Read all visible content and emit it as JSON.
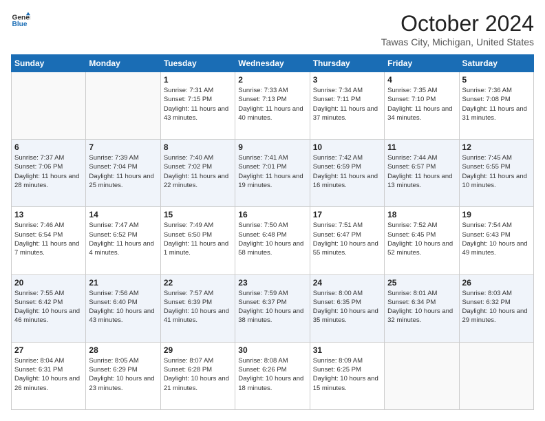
{
  "logo": {
    "line1": "General",
    "line2": "Blue"
  },
  "header": {
    "title": "October 2024",
    "location": "Tawas City, Michigan, United States"
  },
  "weekdays": [
    "Sunday",
    "Monday",
    "Tuesday",
    "Wednesday",
    "Thursday",
    "Friday",
    "Saturday"
  ],
  "weeks": [
    [
      {
        "day": "",
        "info": ""
      },
      {
        "day": "",
        "info": ""
      },
      {
        "day": "1",
        "info": "Sunrise: 7:31 AM\nSunset: 7:15 PM\nDaylight: 11 hours and 43 minutes."
      },
      {
        "day": "2",
        "info": "Sunrise: 7:33 AM\nSunset: 7:13 PM\nDaylight: 11 hours and 40 minutes."
      },
      {
        "day": "3",
        "info": "Sunrise: 7:34 AM\nSunset: 7:11 PM\nDaylight: 11 hours and 37 minutes."
      },
      {
        "day": "4",
        "info": "Sunrise: 7:35 AM\nSunset: 7:10 PM\nDaylight: 11 hours and 34 minutes."
      },
      {
        "day": "5",
        "info": "Sunrise: 7:36 AM\nSunset: 7:08 PM\nDaylight: 11 hours and 31 minutes."
      }
    ],
    [
      {
        "day": "6",
        "info": "Sunrise: 7:37 AM\nSunset: 7:06 PM\nDaylight: 11 hours and 28 minutes."
      },
      {
        "day": "7",
        "info": "Sunrise: 7:39 AM\nSunset: 7:04 PM\nDaylight: 11 hours and 25 minutes."
      },
      {
        "day": "8",
        "info": "Sunrise: 7:40 AM\nSunset: 7:02 PM\nDaylight: 11 hours and 22 minutes."
      },
      {
        "day": "9",
        "info": "Sunrise: 7:41 AM\nSunset: 7:01 PM\nDaylight: 11 hours and 19 minutes."
      },
      {
        "day": "10",
        "info": "Sunrise: 7:42 AM\nSunset: 6:59 PM\nDaylight: 11 hours and 16 minutes."
      },
      {
        "day": "11",
        "info": "Sunrise: 7:44 AM\nSunset: 6:57 PM\nDaylight: 11 hours and 13 minutes."
      },
      {
        "day": "12",
        "info": "Sunrise: 7:45 AM\nSunset: 6:55 PM\nDaylight: 11 hours and 10 minutes."
      }
    ],
    [
      {
        "day": "13",
        "info": "Sunrise: 7:46 AM\nSunset: 6:54 PM\nDaylight: 11 hours and 7 minutes."
      },
      {
        "day": "14",
        "info": "Sunrise: 7:47 AM\nSunset: 6:52 PM\nDaylight: 11 hours and 4 minutes."
      },
      {
        "day": "15",
        "info": "Sunrise: 7:49 AM\nSunset: 6:50 PM\nDaylight: 11 hours and 1 minute."
      },
      {
        "day": "16",
        "info": "Sunrise: 7:50 AM\nSunset: 6:48 PM\nDaylight: 10 hours and 58 minutes."
      },
      {
        "day": "17",
        "info": "Sunrise: 7:51 AM\nSunset: 6:47 PM\nDaylight: 10 hours and 55 minutes."
      },
      {
        "day": "18",
        "info": "Sunrise: 7:52 AM\nSunset: 6:45 PM\nDaylight: 10 hours and 52 minutes."
      },
      {
        "day": "19",
        "info": "Sunrise: 7:54 AM\nSunset: 6:43 PM\nDaylight: 10 hours and 49 minutes."
      }
    ],
    [
      {
        "day": "20",
        "info": "Sunrise: 7:55 AM\nSunset: 6:42 PM\nDaylight: 10 hours and 46 minutes."
      },
      {
        "day": "21",
        "info": "Sunrise: 7:56 AM\nSunset: 6:40 PM\nDaylight: 10 hours and 43 minutes."
      },
      {
        "day": "22",
        "info": "Sunrise: 7:57 AM\nSunset: 6:39 PM\nDaylight: 10 hours and 41 minutes."
      },
      {
        "day": "23",
        "info": "Sunrise: 7:59 AM\nSunset: 6:37 PM\nDaylight: 10 hours and 38 minutes."
      },
      {
        "day": "24",
        "info": "Sunrise: 8:00 AM\nSunset: 6:35 PM\nDaylight: 10 hours and 35 minutes."
      },
      {
        "day": "25",
        "info": "Sunrise: 8:01 AM\nSunset: 6:34 PM\nDaylight: 10 hours and 32 minutes."
      },
      {
        "day": "26",
        "info": "Sunrise: 8:03 AM\nSunset: 6:32 PM\nDaylight: 10 hours and 29 minutes."
      }
    ],
    [
      {
        "day": "27",
        "info": "Sunrise: 8:04 AM\nSunset: 6:31 PM\nDaylight: 10 hours and 26 minutes."
      },
      {
        "day": "28",
        "info": "Sunrise: 8:05 AM\nSunset: 6:29 PM\nDaylight: 10 hours and 23 minutes."
      },
      {
        "day": "29",
        "info": "Sunrise: 8:07 AM\nSunset: 6:28 PM\nDaylight: 10 hours and 21 minutes."
      },
      {
        "day": "30",
        "info": "Sunrise: 8:08 AM\nSunset: 6:26 PM\nDaylight: 10 hours and 18 minutes."
      },
      {
        "day": "31",
        "info": "Sunrise: 8:09 AM\nSunset: 6:25 PM\nDaylight: 10 hours and 15 minutes."
      },
      {
        "day": "",
        "info": ""
      },
      {
        "day": "",
        "info": ""
      }
    ]
  ]
}
